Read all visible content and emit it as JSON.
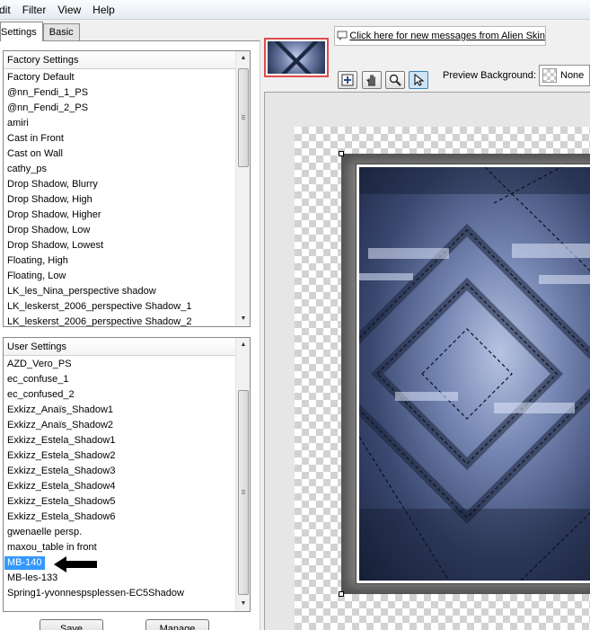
{
  "menu": [
    "dit",
    "Filter",
    "View",
    "Help"
  ],
  "tabs": {
    "settings": "Settings",
    "basic": "Basic"
  },
  "factory": {
    "header": "Factory Settings",
    "items": [
      "Factory Default",
      "@nn_Fendi_1_PS",
      "@nn_Fendi_2_PS",
      "amiri",
      "Cast in Front",
      "Cast on Wall",
      "cathy_ps",
      "Drop Shadow, Blurry",
      "Drop Shadow, High",
      "Drop Shadow, Higher",
      "Drop Shadow, Low",
      "Drop Shadow, Lowest",
      "Floating, High",
      "Floating, Low",
      "LK_les_Nina_perspective shadow",
      "LK_leskerst_2006_perspective Shadow_1",
      "LK_leskerst_2006_perspective Shadow_2"
    ]
  },
  "user": {
    "header": "User Settings",
    "items": [
      "AZD_Vero_PS",
      "ec_confuse_1",
      "ec_confused_2",
      "Exkizz_Anaïs_Shadow1",
      "Exkizz_Anaïs_Shadow2",
      "Exkizz_Estela_Shadow1",
      "Exkizz_Estela_Shadow2",
      "Exkizz_Estela_Shadow3",
      "Exkizz_Estela_Shadow4",
      "Exkizz_Estela_Shadow5",
      "Exkizz_Estela_Shadow6",
      "gwenaelle persp.",
      "maxou_table in front",
      "MB-140",
      "MB-les-133",
      "Spring1-yvonnespsplessen-EC5Shadow"
    ],
    "selected": "MB-140"
  },
  "buttons": {
    "save": "Save",
    "manage": "Manage"
  },
  "message_link": "Click here for new messages from Alien Skin",
  "preview_background": {
    "label": "Preview Background:",
    "value": "None"
  },
  "icons": {
    "message": "message-icon",
    "tools": [
      "navigate-icon",
      "hand-icon",
      "zoom-icon",
      "pointer-icon"
    ],
    "annotation": "black-arrow-icon"
  },
  "colors": {
    "selection": "#3399ff",
    "thumbnail_border": "#e34a4a"
  }
}
